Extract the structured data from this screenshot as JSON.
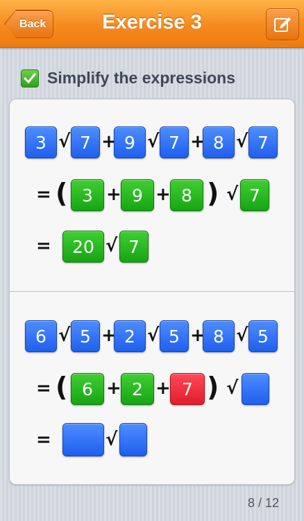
{
  "header": {
    "title": "Exercise 3",
    "back_label": "Back"
  },
  "instruction": "Simplify the expressions",
  "problems": [
    {
      "line1": [
        "3",
        "7",
        "9",
        "7",
        "8",
        "7"
      ],
      "line2": [
        "3",
        "9",
        "8",
        "7"
      ],
      "line3": [
        "20",
        "7"
      ]
    },
    {
      "line1": [
        "6",
        "5",
        "2",
        "5",
        "8",
        "5"
      ],
      "line2": [
        "6",
        "2",
        "7",
        ""
      ],
      "line3": [
        "",
        ""
      ]
    }
  ],
  "symbols": {
    "sqrt": "√",
    "plus": "+",
    "equals": "=",
    "lparen": "(",
    "rparen": ")"
  },
  "pagination": "8 / 12",
  "colors": {
    "header": "#f58a1f",
    "tile_blue": "#2f6ff5",
    "tile_green": "#22b31c",
    "tile_red": "#f02a38"
  }
}
